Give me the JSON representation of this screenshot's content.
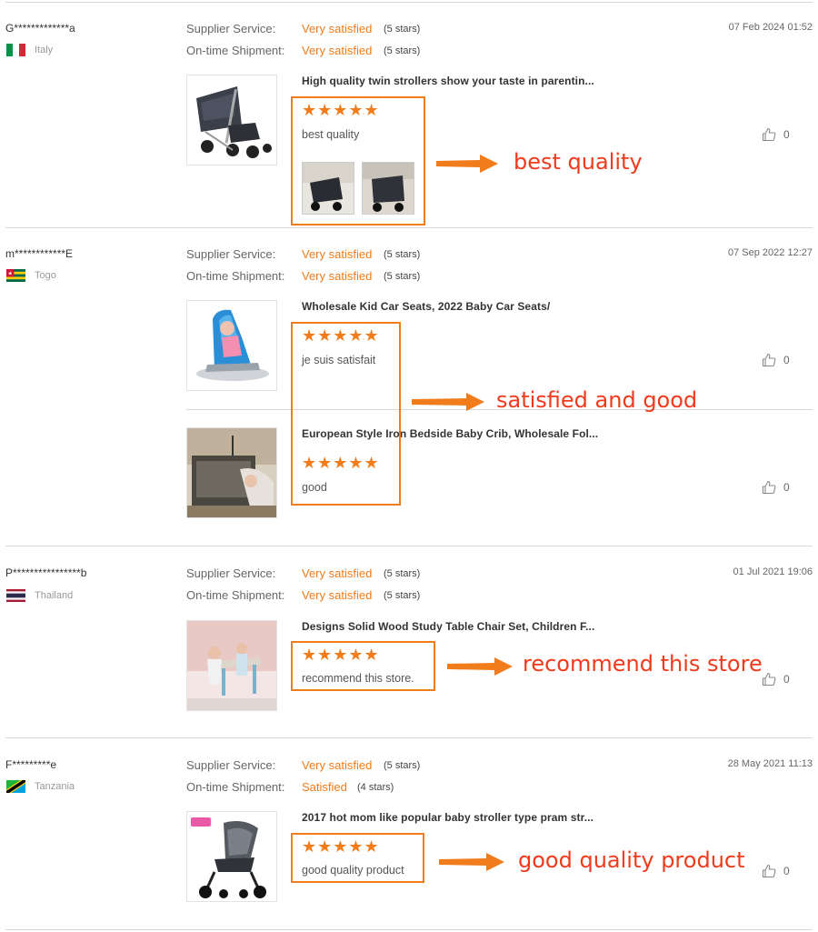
{
  "labels": {
    "supplier_service": "Supplier Service:",
    "ontime_shipment": "On-time Shipment:"
  },
  "colors": {
    "accent": "#f07c1c",
    "annotation_text": "#f03a1c",
    "divider": "#d8d8d8"
  },
  "reviews": [
    {
      "buyer": "G*************a",
      "country": "Italy",
      "flag": "italy-flag-icon",
      "supplier_service": "Very satisfied",
      "supplier_stars": "(5 stars)",
      "shipment": "Very satisfied",
      "shipment_stars": "(5 stars)",
      "date": "07 Feb 2024 01:52",
      "products": [
        {
          "title": "High quality twin strollers show your taste in parentin...",
          "rating": 5,
          "stars": "★★★★★",
          "comment": "best quality",
          "likes": "0",
          "image": "twin-stroller-image"
        }
      ],
      "annotation": "best quality"
    },
    {
      "buyer": "m************E",
      "country": "Togo",
      "flag": "togo-flag-icon",
      "supplier_service": "Very satisfied",
      "supplier_stars": "(5 stars)",
      "shipment": "Very satisfied",
      "shipment_stars": "(5 stars)",
      "date": "07 Sep 2022 12:27",
      "products": [
        {
          "title": "Wholesale Kid Car Seats, 2022 Baby Car Seats/",
          "rating": 5,
          "stars": "★★★★★",
          "comment": "je suis satisfait",
          "likes": "0",
          "image": "car-seat-image"
        },
        {
          "title": "European Style Iron Bedside Baby Crib, Wholesale Fol...",
          "rating": 5,
          "stars": "★★★★★",
          "comment": "good",
          "likes": "0",
          "image": "baby-crib-image"
        }
      ],
      "annotation": "satisfied and good"
    },
    {
      "buyer": "P****************b",
      "country": "Thailand",
      "flag": "thailand-flag-icon",
      "supplier_service": "Very satisfied",
      "supplier_stars": "(5 stars)",
      "shipment": "Very satisfied",
      "shipment_stars": "(5 stars)",
      "date": "01 Jul 2021 19:06",
      "products": [
        {
          "title": "Designs Solid Wood Study Table Chair Set, Children F...",
          "rating": 5,
          "stars": "★★★★★",
          "comment": "recommend this store.",
          "likes": "0",
          "image": "study-table-image"
        }
      ],
      "annotation": "recommend this store"
    },
    {
      "buyer": "F*********e",
      "country": "Tanzania",
      "flag": "tanzania-flag-icon",
      "supplier_service": "Very satisfied",
      "supplier_stars": "(5 stars)",
      "shipment": "Satisfied",
      "shipment_stars": "(4 stars)",
      "date": "28 May 2021 11:13",
      "products": [
        {
          "title": "2017 hot mom like popular baby stroller type pram str...",
          "rating": 5,
          "stars": "★★★★★",
          "comment": "good quality product",
          "likes": "0",
          "image": "baby-stroller-image"
        }
      ],
      "annotation": "good quality product"
    }
  ]
}
